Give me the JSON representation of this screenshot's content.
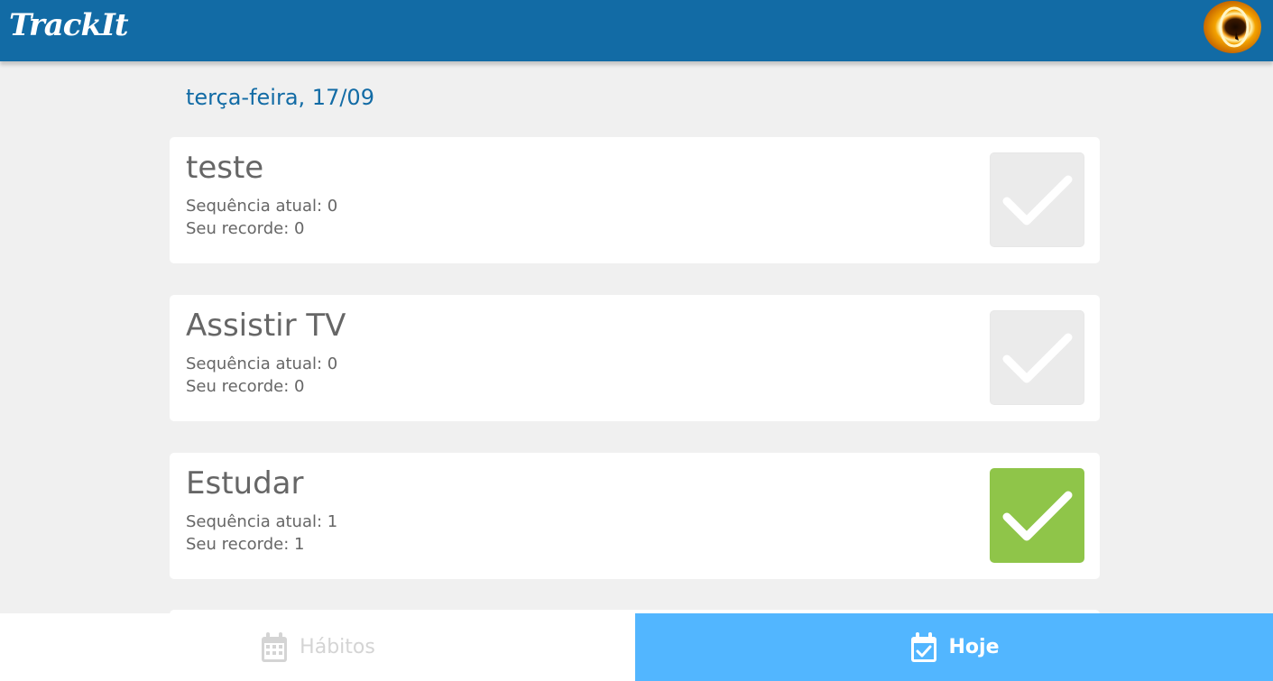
{
  "app": {
    "logo": "TrackIt",
    "brand_color": "#126ba5",
    "accent_color": "#52b6ff",
    "done_color": "#8fc549"
  },
  "header": {
    "date": "terça-feira, 17/09",
    "avatar_icon": "avatar"
  },
  "habits": [
    {
      "name": "teste",
      "current": "Sequência atual: 0",
      "record": "Seu recorde: 0",
      "done": false
    },
    {
      "name": "Assistir TV",
      "current": "Sequência atual: 0",
      "record": "Seu recorde: 0",
      "done": false
    },
    {
      "name": "Estudar",
      "current": "Sequência atual: 1",
      "record": "Seu recorde: 1",
      "done": true
    }
  ],
  "footer": {
    "habits_label": "Hábitos",
    "habits_icon": "calendar-icon",
    "today_label": "Hoje",
    "today_icon": "calendar-check-icon"
  }
}
